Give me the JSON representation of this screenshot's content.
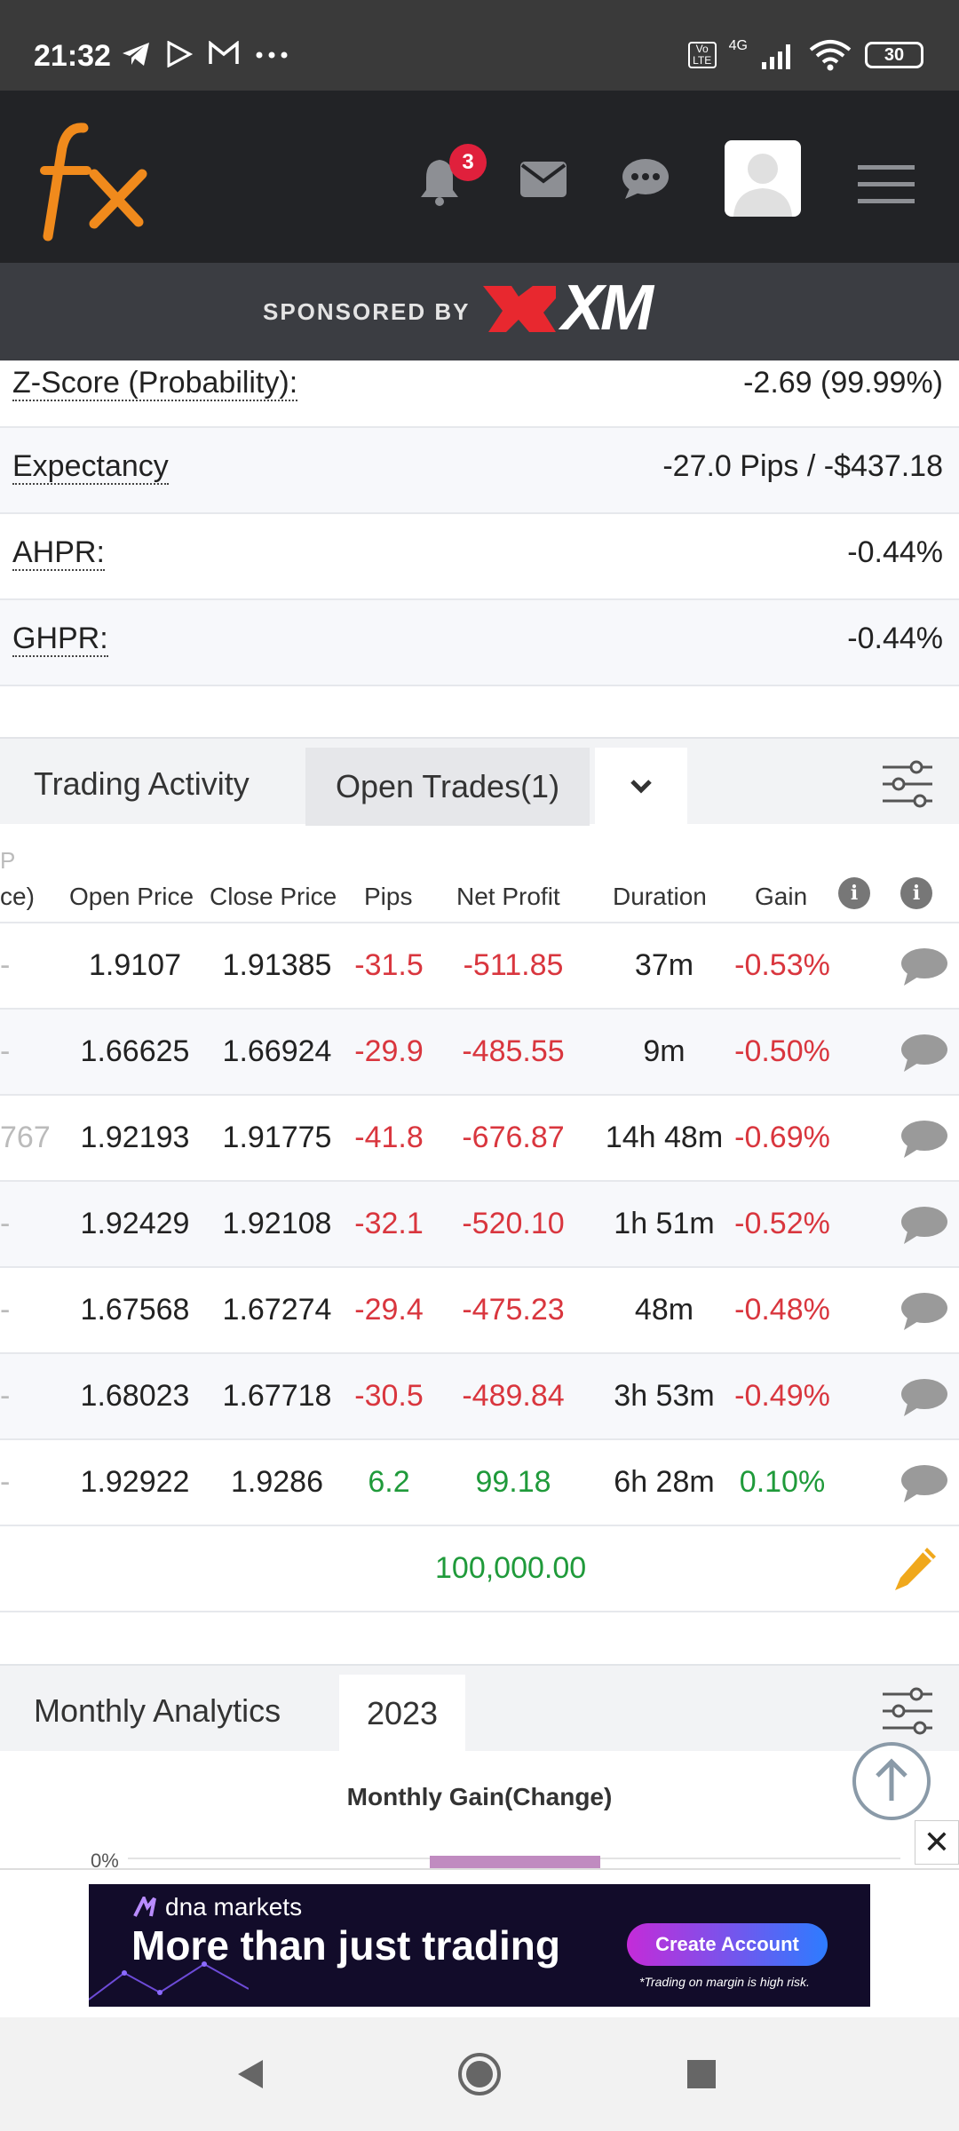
{
  "status_bar": {
    "time": "21:32",
    "network": "4G",
    "volte": "Vo LTE",
    "battery": "30"
  },
  "header": {
    "notifications_count": "3"
  },
  "sponsor": {
    "label": "SPONSORED BY",
    "brand": "XM"
  },
  "stats": [
    {
      "label": "Z-Score (Probability):",
      "value": "-2.69 (99.99%)"
    },
    {
      "label": "Expectancy",
      "value": "-27.0 Pips / -$437.18"
    },
    {
      "label": "AHPR:",
      "value": "-0.44%"
    },
    {
      "label": "GHPR:",
      "value": "-0.44%"
    }
  ],
  "trading": {
    "title": "Trading Activity",
    "tab_open": "Open Trades(1)",
    "truncated_header_top": "P",
    "truncated_header": "ce)",
    "columns": [
      "Open Price",
      "Close Price",
      "Pips",
      "Net Profit",
      "Duration",
      "Gain"
    ],
    "rows": [
      {
        "lead": "-",
        "open": "1.9107",
        "close": "1.91385",
        "pips": "-31.5",
        "profit": "-511.85",
        "duration": "37m",
        "gain": "-0.53%",
        "sign": "neg"
      },
      {
        "lead": "-",
        "open": "1.66625",
        "close": "1.66924",
        "pips": "-29.9",
        "profit": "-485.55",
        "duration": "9m",
        "gain": "-0.50%",
        "sign": "neg"
      },
      {
        "lead": "767",
        "open": "1.92193",
        "close": "1.91775",
        "pips": "-41.8",
        "profit": "-676.87",
        "duration": "14h 48m",
        "gain": "-0.69%",
        "sign": "neg"
      },
      {
        "lead": "-",
        "open": "1.92429",
        "close": "1.92108",
        "pips": "-32.1",
        "profit": "-520.10",
        "duration": "1h 51m",
        "gain": "-0.52%",
        "sign": "neg"
      },
      {
        "lead": "-",
        "open": "1.67568",
        "close": "1.67274",
        "pips": "-29.4",
        "profit": "-475.23",
        "duration": "48m",
        "gain": "-0.48%",
        "sign": "neg"
      },
      {
        "lead": "-",
        "open": "1.68023",
        "close": "1.67718",
        "pips": "-30.5",
        "profit": "-489.84",
        "duration": "3h 53m",
        "gain": "-0.49%",
        "sign": "neg"
      },
      {
        "lead": "-",
        "open": "1.92922",
        "close": "1.9286",
        "pips": "6.2",
        "profit": "99.18",
        "duration": "6h 28m",
        "gain": "0.10%",
        "sign": "pos"
      }
    ],
    "total": "100,000.00"
  },
  "monthly": {
    "title": "Monthly Analytics",
    "year_tab": "2023"
  },
  "chart_data": {
    "type": "bar",
    "title": "Monthly Gain(Change)",
    "ytick_labels": [
      "0%"
    ],
    "series": [
      {
        "values": []
      }
    ]
  },
  "ad": {
    "brand": "dna markets",
    "headline": "More than just trading",
    "cta": "Create Account",
    "note": "*Trading on margin is high risk."
  },
  "colors": {
    "negative": "#d9363e",
    "positive": "#1f9a3a",
    "header_bg": "#222326",
    "bar": "#c08bc0"
  }
}
